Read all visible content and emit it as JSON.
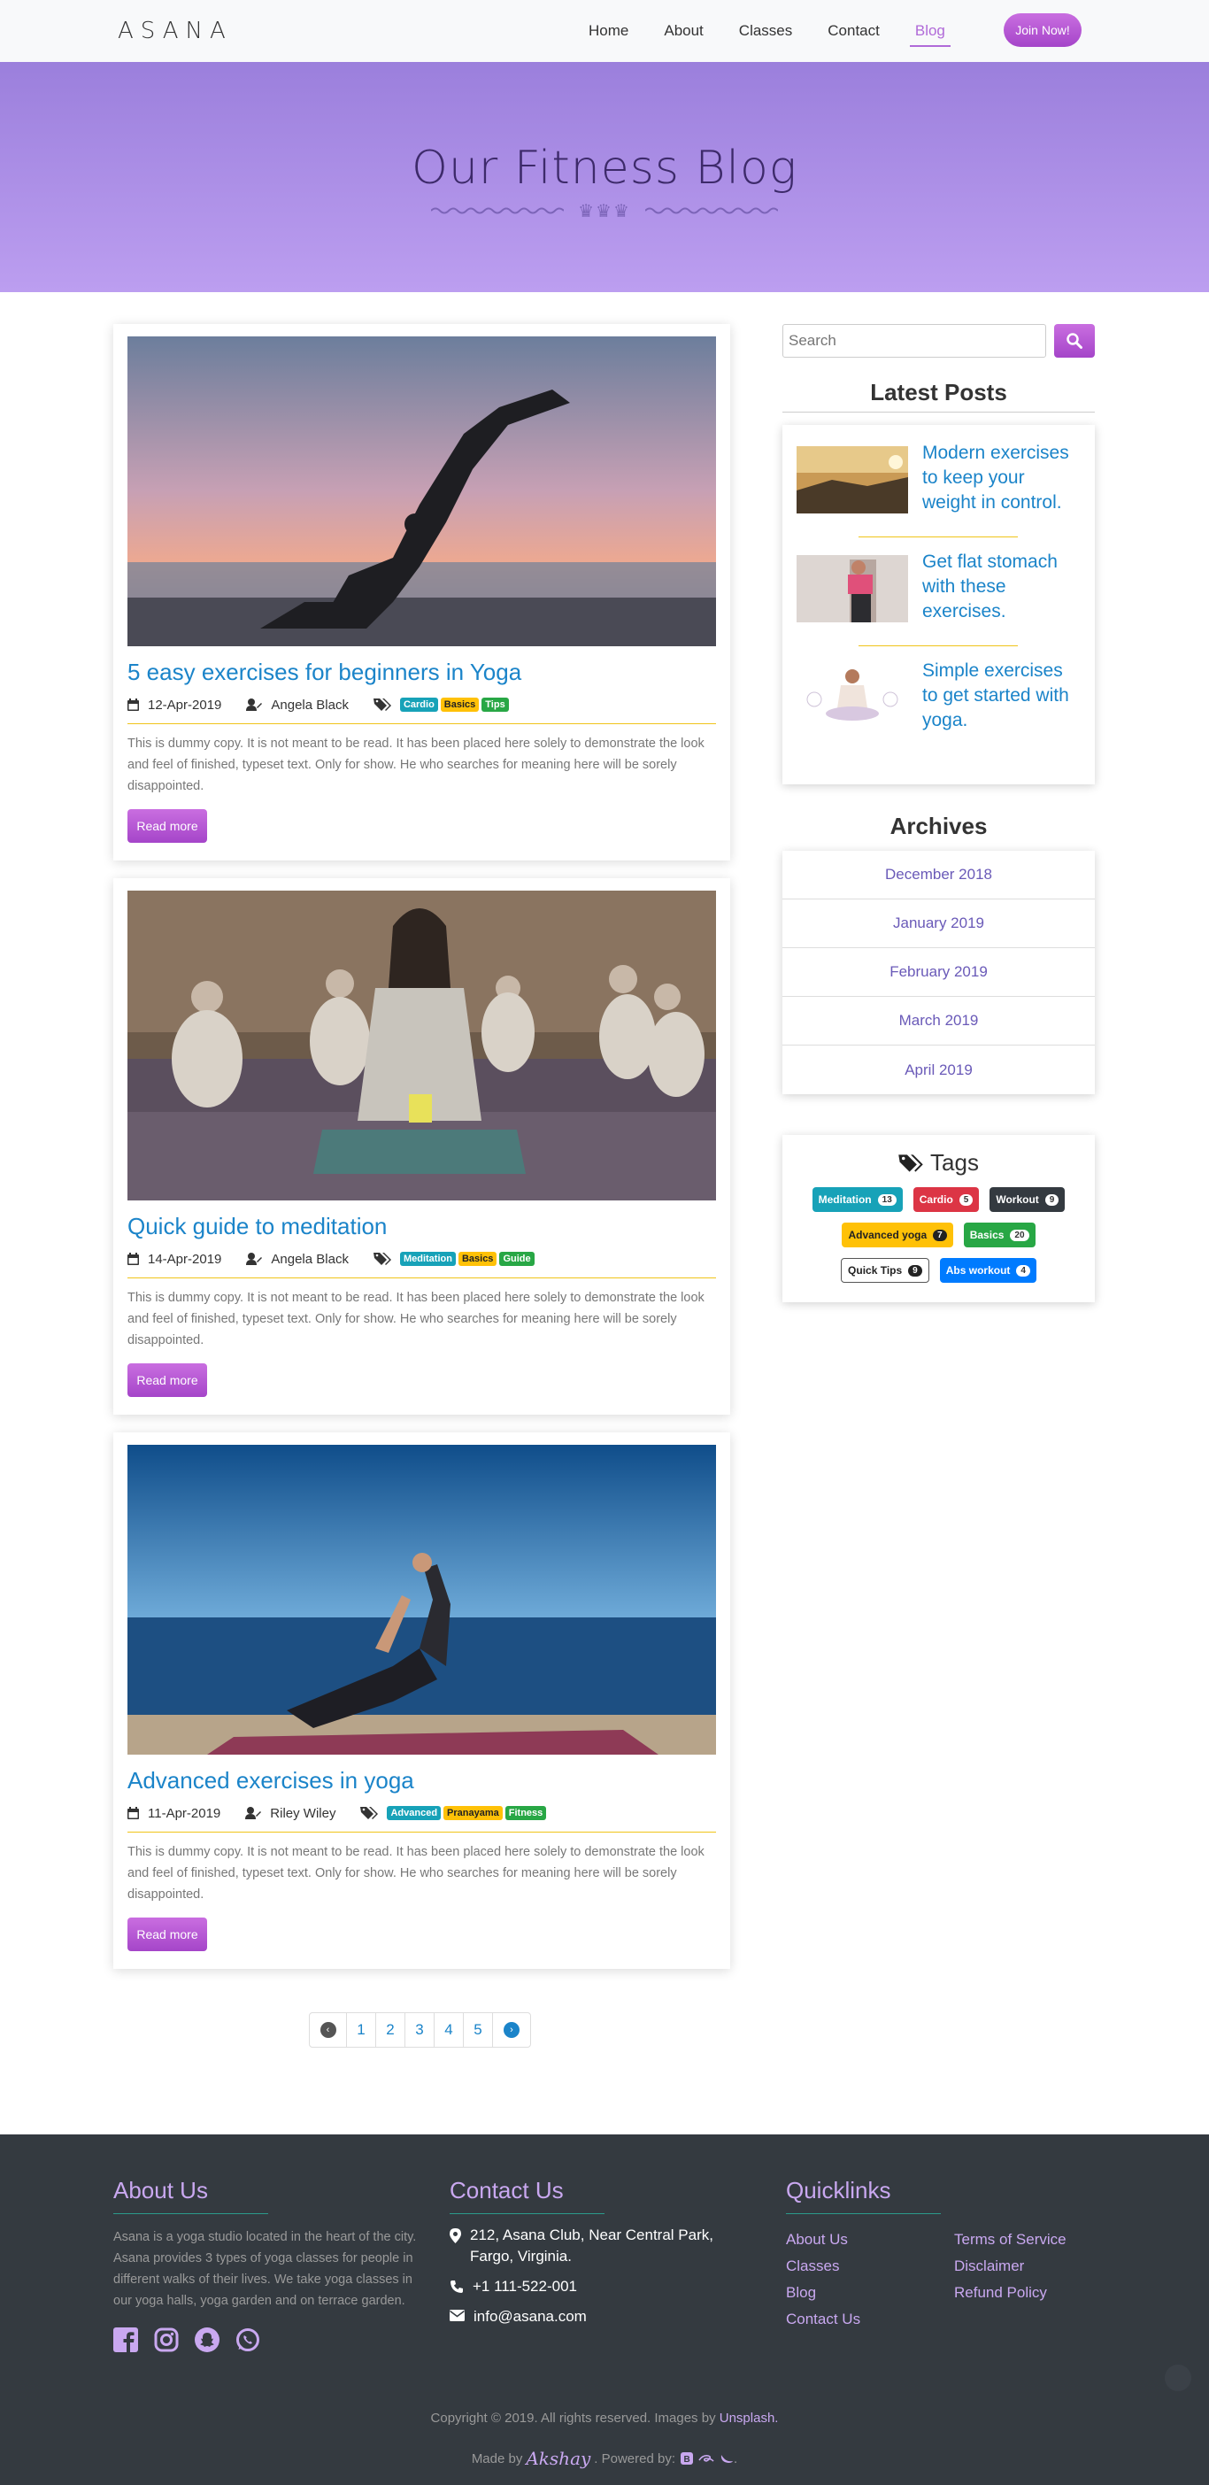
{
  "nav": {
    "brand": "ASANA",
    "links": [
      "Home",
      "About",
      "Classes",
      "Contact",
      "Blog"
    ],
    "active_index": 4,
    "cta": "Join Now!"
  },
  "hero": {
    "title": "Our Fitness Blog"
  },
  "posts": [
    {
      "title": "5 easy exercises for beginners in Yoga",
      "date": "12-Apr-2019",
      "author": "Angela Black",
      "tags": [
        "Cardio",
        "Basics",
        "Tips"
      ],
      "excerpt": "This is dummy copy. It is not meant to be read. It has been placed here solely to demonstrate the look and feel of finished, typeset text. Only for show. He who searches for meaning here will be sorely disappointed.",
      "button": "Read more"
    },
    {
      "title": "Quick guide to meditation",
      "date": "14-Apr-2019",
      "author": "Angela Black",
      "tags": [
        "Meditation",
        "Basics",
        "Guide"
      ],
      "excerpt": "This is dummy copy. It is not meant to be read. It has been placed here solely to demonstrate the look and feel of finished, typeset text. Only for show. He who searches for meaning here will be sorely disappointed.",
      "button": "Read more"
    },
    {
      "title": "Advanced exercises in yoga",
      "date": "11-Apr-2019",
      "author": "Riley Wiley",
      "tags": [
        "Advanced",
        "Pranayama",
        "Fitness"
      ],
      "excerpt": "This is dummy copy. It is not meant to be read. It has been placed here solely to demonstrate the look and feel of finished, typeset text. Only for show. He who searches for meaning here will be sorely disappointed.",
      "button": "Read more"
    }
  ],
  "pagination": {
    "pages": [
      "1",
      "2",
      "3",
      "4",
      "5"
    ]
  },
  "sidebar": {
    "search_placeholder": "Search",
    "latest_title": "Latest Posts",
    "latest": [
      "Modern exercises to keep your weight in control.",
      "Get flat stomach with these exercises.",
      "Simple exercises to get started with yoga."
    ],
    "archives_title": "Archives",
    "archives": [
      "December 2018",
      "January 2019",
      "February 2019",
      "March 2019",
      "April 2019"
    ],
    "tags_title": "Tags",
    "tags": [
      {
        "label": "Meditation",
        "count": "13"
      },
      {
        "label": "Cardio",
        "count": "5"
      },
      {
        "label": "Workout",
        "count": "9"
      },
      {
        "label": "Advanced yoga",
        "count": "7"
      },
      {
        "label": "Basics",
        "count": "20"
      },
      {
        "label": "Quick Tips",
        "count": "9"
      },
      {
        "label": "Abs workout",
        "count": "4"
      }
    ]
  },
  "footer": {
    "about_title": "About Us",
    "about_text": "Asana is a yoga studio located in the heart of the city. Asana provides 3 types of yoga classes for people in different walks of their lives. We take yoga classes in our yoga halls, yoga garden and on terrace garden.",
    "contact_title": "Contact Us",
    "address": "212, Asana Club, Near Central Park, Fargo, Virginia.",
    "phone": "+1 111-522-001",
    "email": "info@asana.com",
    "quicklinks_title": "Quicklinks",
    "quicklinks_left": [
      "About Us",
      "Classes",
      "Blog",
      "Contact Us"
    ],
    "quicklinks_right": [
      "Terms of Service",
      "Disclaimer",
      "Refund Policy"
    ],
    "copyright_pre": "Copyright © 2019. All rights reserved. Images by",
    "copyright_link": "Unsplash.",
    "made_by": "Made by",
    "made_by_name": "Akshay",
    "powered_by": ". Powered by:"
  },
  "colors": {
    "accent": "#b06ad8",
    "link_blue": "#1b84c9",
    "hero_top": "#9b7fdc",
    "hero_bottom": "#bc9ef0",
    "footer_bg": "#343a40"
  }
}
